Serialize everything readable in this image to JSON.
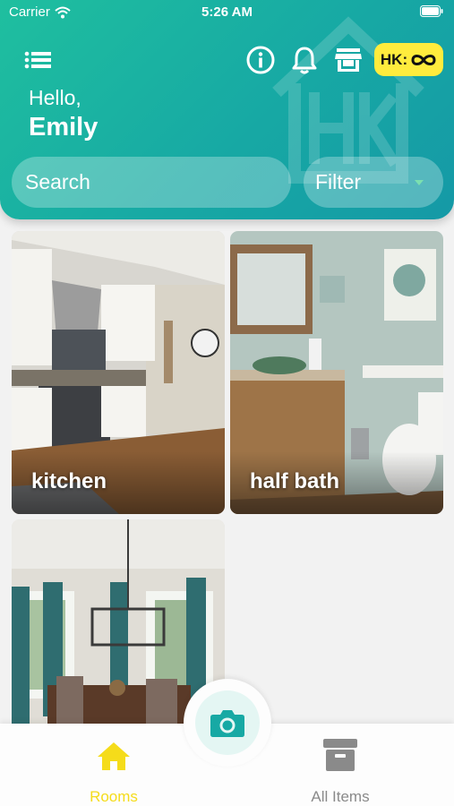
{
  "status_bar": {
    "carrier": "Carrier",
    "time": "5:26 AM"
  },
  "header": {
    "badge_label": "HK:",
    "greeting": "Hello,",
    "username": "Emily"
  },
  "search": {
    "placeholder": "Search"
  },
  "filter": {
    "label": "Filter"
  },
  "rooms": [
    {
      "label": "kitchen"
    },
    {
      "label": "half bath"
    },
    {
      "label": ""
    }
  ],
  "tabs": [
    {
      "label": "Rooms",
      "active": true
    },
    {
      "label": "All Items",
      "active": false
    }
  ],
  "colors": {
    "accent": "#17a9a4",
    "badge": "#ffec3d",
    "active_tab": "#f5dc1a",
    "inactive_tab": "#8a8a8a"
  },
  "icons": [
    "menu-icon",
    "info-icon",
    "bell-icon",
    "store-icon",
    "infinity-icon",
    "camera-icon",
    "home-icon",
    "archive-icon"
  ]
}
